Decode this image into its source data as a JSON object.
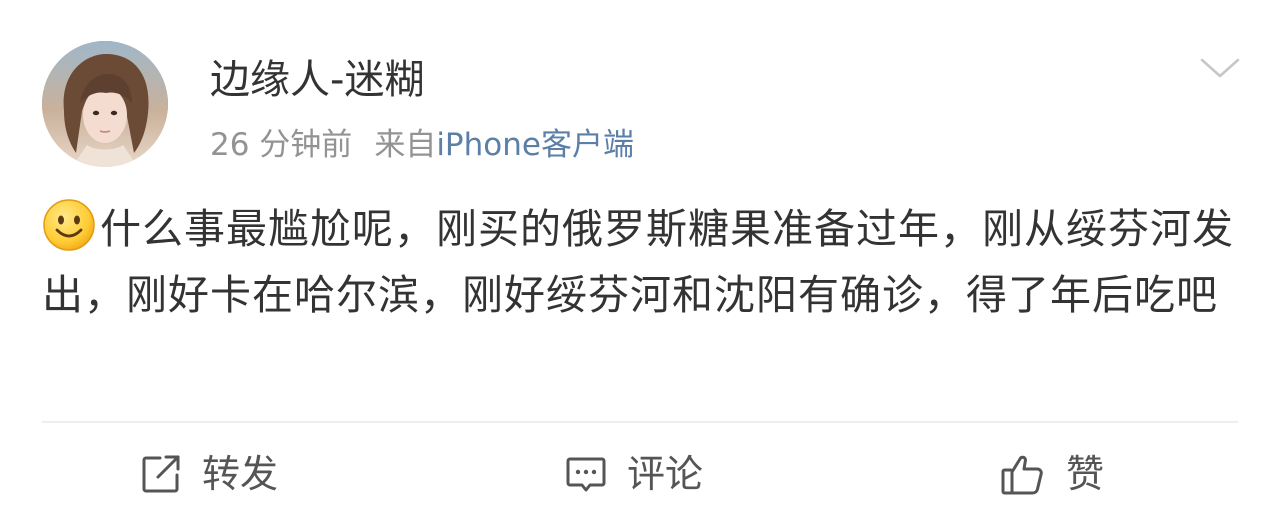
{
  "post": {
    "author": "边缘人-迷糊",
    "time": "26 分钟前",
    "from_label": "来自",
    "source": "iPhone客户端",
    "emoji": "smile-emoji",
    "content": "什么事最尴尬呢，刚买的俄罗斯糖果准备过年，刚从绥芬河发出，刚好卡在哈尔滨，刚好绥芬河和沈阳有确诊，得了年后吃吧"
  },
  "actions": {
    "repost_label": "转发",
    "comment_label": "评论",
    "like_label": "赞"
  },
  "colors": {
    "text": "#333333",
    "meta": "#939393",
    "source_link": "#5b7fa7",
    "action_text": "#555555",
    "divider": "#eeeeee"
  },
  "icons": {
    "menu": "chevron-down-icon",
    "repost": "repost-icon",
    "comment": "comment-icon",
    "like": "thumbs-up-icon"
  }
}
